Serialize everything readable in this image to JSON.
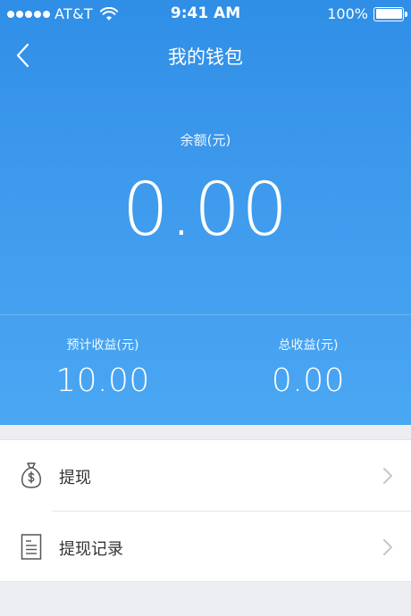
{
  "status_bar": {
    "carrier": "AT&T",
    "time": "9:41 AM",
    "battery": "100%"
  },
  "nav": {
    "title": "我的钱包",
    "back_icon": "chevron-left-icon"
  },
  "balance": {
    "label": "余额(元)",
    "value": "0.00"
  },
  "earnings": [
    {
      "label": "预计收益(元)",
      "value": "10.00"
    },
    {
      "label": "总收益(元)",
      "value": "0.00"
    }
  ],
  "menu": [
    {
      "label": "提现",
      "icon": "money-bag-icon"
    },
    {
      "label": "提现记录",
      "icon": "document-icon"
    }
  ],
  "colors": {
    "header_top": "#2f8ee6",
    "header_bottom": "#4aa7f3",
    "page_bg": "#eceef1"
  }
}
